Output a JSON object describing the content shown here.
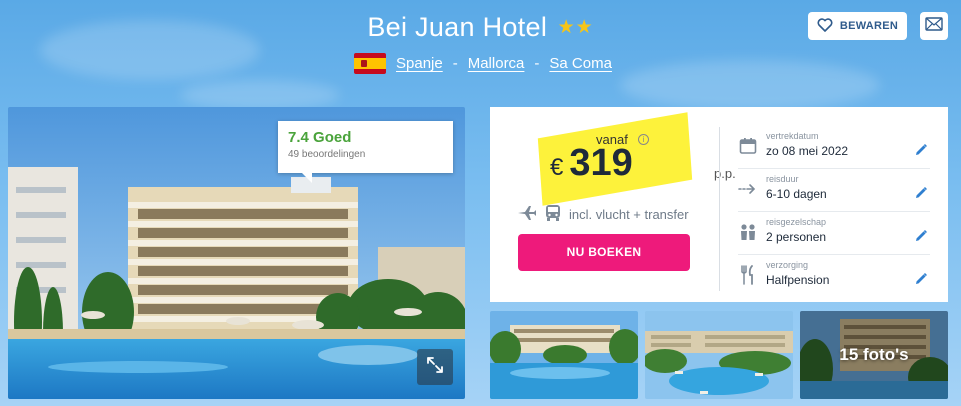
{
  "hotel": {
    "title": "Bei Juan Hotel",
    "stars": "★★",
    "star_count": 2
  },
  "location": {
    "country": "Spanje",
    "region": "Mallorca",
    "city": "Sa Coma",
    "separator": "-",
    "flag": "spain-flag"
  },
  "actions": {
    "save_label": "BEWAREN",
    "save_icon": "heart-icon",
    "mail_icon": "mail-icon"
  },
  "rating": {
    "score": "7.4",
    "label": "Goed",
    "count": "49 beoordelingen"
  },
  "booking": {
    "from_label": "vanaf",
    "currency": "€",
    "price": "319",
    "per_person": "p.p.",
    "includes": "incl. vlucht + transfer",
    "book_label": "NU BOEKEN"
  },
  "details": [
    {
      "icon": "calendar-icon",
      "label": "vertrekdatum",
      "value": "zo 08 mei 2022"
    },
    {
      "icon": "duration-arrow-icon",
      "label": "reisduur",
      "value": "6-10 dagen"
    },
    {
      "icon": "people-icon",
      "label": "reisgezelschap",
      "value": "2 personen"
    },
    {
      "icon": "cutlery-icon",
      "label": "verzorging",
      "value": "Halfpension"
    }
  ],
  "gallery": {
    "more_photos_label": "15 foto's"
  },
  "colors": {
    "accent_pink": "#ee1a7b",
    "rating_green": "#4aa33b",
    "star_gold": "#f5c518",
    "price_highlight": "#fdf23b",
    "link_blue": "#2f5b8c"
  }
}
